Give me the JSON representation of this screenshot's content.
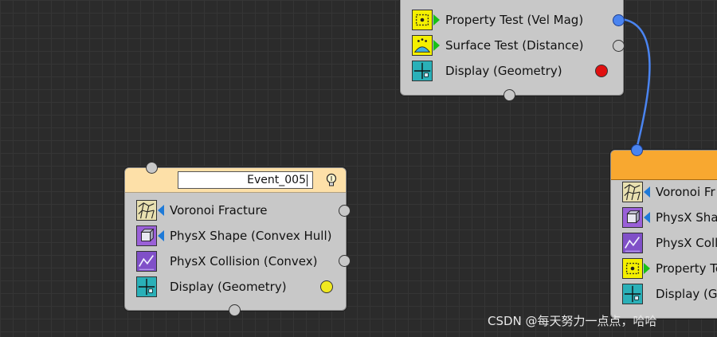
{
  "colors": {
    "canvas": "#2b2b2b",
    "node_body": "#c8c8c8",
    "header_idle": "#fde0a8",
    "header_active": "#f8a830",
    "wire": "#4a84f0",
    "display_dot_top": "#e01010",
    "display_dot_left": "#f0e820"
  },
  "top_node": {
    "operators": [
      {
        "label": "Property Test (Vel Mag)",
        "icon": "property-test-icon"
      },
      {
        "label": "Surface Test (Distance)",
        "icon": "surface-test-icon"
      },
      {
        "label": "Display (Geometry)",
        "icon": "display-icon"
      }
    ]
  },
  "left_node": {
    "name": "Event_005",
    "operators": [
      {
        "label": "Voronoi Fracture",
        "icon": "voronoi-fracture-icon"
      },
      {
        "label": "PhysX Shape (Convex Hull)",
        "icon": "physx-shape-icon"
      },
      {
        "label": "PhysX Collision (Convex)",
        "icon": "physx-collision-icon"
      },
      {
        "label": "Display (Geometry)",
        "icon": "display-icon"
      }
    ]
  },
  "right_node": {
    "operators": [
      {
        "label": "Voronoi Fr",
        "icon": "voronoi-fracture-icon"
      },
      {
        "label": "PhysX Shap",
        "icon": "physx-shape-icon"
      },
      {
        "label": "PhysX Colli",
        "icon": "physx-collision-icon"
      },
      {
        "label": "Property Te",
        "icon": "property-test-icon"
      },
      {
        "label": "Display (Ge",
        "icon": "display-icon"
      }
    ]
  },
  "watermark": "CSDN @每天努力一点点，哈哈"
}
